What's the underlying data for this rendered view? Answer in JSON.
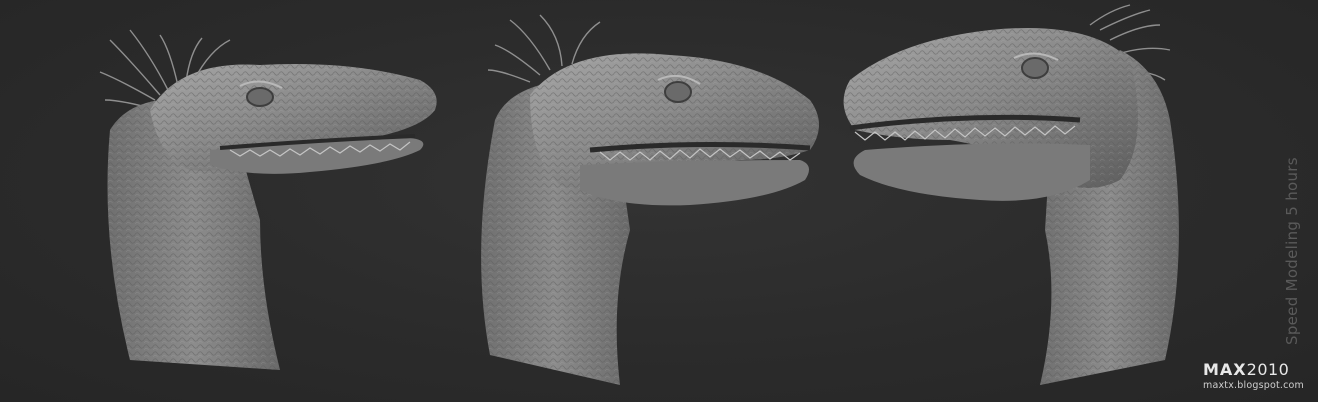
{
  "caption": "Speed Modeling 5 hours",
  "logo": {
    "brand": "MAX",
    "year": "2010",
    "url": "maxtx.blogspot.com"
  },
  "renders": [
    {
      "subject": "velociraptor head sculpt, facing right"
    },
    {
      "subject": "velociraptor head sculpt, facing right, three-quarter view"
    },
    {
      "subject": "velociraptor head sculpt, facing left"
    }
  ],
  "colors": {
    "background": "#2b2b2b",
    "clay": "#8a8a8a",
    "caption": "#5a5a5a",
    "logo": "#e8e8e8"
  }
}
